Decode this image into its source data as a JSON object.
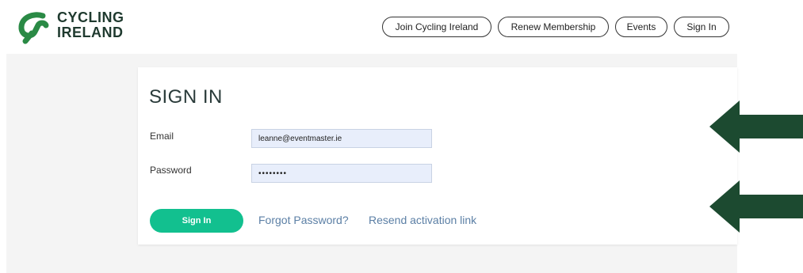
{
  "brand": {
    "line1": "CYCLING",
    "line2": "IRELAND",
    "logo_icon": "cycling-ireland-logo-icon",
    "color": "#2a8a45"
  },
  "nav": {
    "items": [
      {
        "label": "Join Cycling Ireland"
      },
      {
        "label": "Renew Membership"
      },
      {
        "label": "Events"
      },
      {
        "label": "Sign In"
      }
    ]
  },
  "signin": {
    "title": "SIGN IN",
    "email_label": "Email",
    "email_value": "leanne@eventmaster.ie",
    "password_label": "Password",
    "password_value": "••••••••",
    "button_label": "Sign In",
    "forgot_link": "Forgot Password?",
    "resend_link": "Resend activation link"
  },
  "annotations": {
    "arrow_color": "#1c4a30",
    "arrow_icon": "left-arrow-icon"
  },
  "colors": {
    "accent": "#12c08f",
    "link": "#5b7fa5",
    "input_bg": "#e8eefb"
  }
}
